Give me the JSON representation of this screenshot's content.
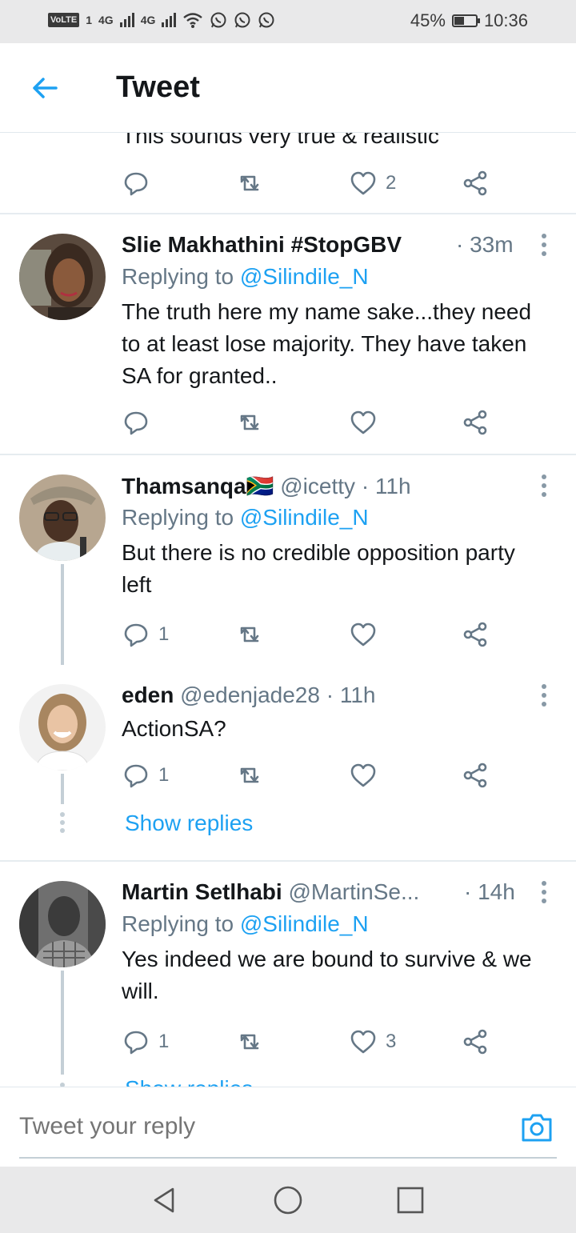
{
  "status_bar": {
    "network_badge": "VoLTE",
    "sim_label": "1",
    "signal1_label": "4G",
    "signal2_label": "4G",
    "battery_percent": "45%",
    "battery_level": 0.45,
    "time": "10:36",
    "icons": [
      "wifi-icon",
      "whatsapp-icon",
      "whatsapp-icon",
      "whatsapp-icon"
    ]
  },
  "header": {
    "title": "Tweet"
  },
  "partial_top": {
    "text": "This sounds very true & realistic",
    "like_count": "2"
  },
  "tweets": [
    {
      "name": "Slie Makhathini #StopGBV",
      "handle": "",
      "time": "· 33m",
      "replying_label": "Replying to ",
      "replying_to": "@Silindile_N",
      "text": "The truth here my name sake...they need to at least lose majority. They have taken SA for granted..",
      "reply_count": "",
      "like_count": ""
    },
    {
      "name": "Thamsanqa🇿🇦",
      "handle": "@icetty",
      "time": "· 11h",
      "replying_label": "Replying to ",
      "replying_to": "@Silindile_N",
      "text": "But there is no credible opposition party left",
      "reply_count": "1",
      "like_count": ""
    },
    {
      "name": "eden",
      "handle": "@edenjade28",
      "time": "· 11h",
      "text": "ActionSA?",
      "reply_count": "1",
      "like_count": "",
      "show_replies": "Show replies"
    },
    {
      "name": "Martin Setlhabi",
      "handle": "@MartinSe...",
      "time": "· 14h",
      "replying_label": "Replying to ",
      "replying_to": "@Silindile_N",
      "text": "Yes indeed we are bound to survive & we will.",
      "reply_count": "1",
      "like_count": "3",
      "show_replies": "Show replies"
    }
  ],
  "reply_bar": {
    "placeholder": "Tweet your reply"
  },
  "colors": {
    "accent": "#1da1f2",
    "secondary_text": "#657786",
    "primary_text": "#14171a",
    "system_bar": "#e9e9ea"
  }
}
